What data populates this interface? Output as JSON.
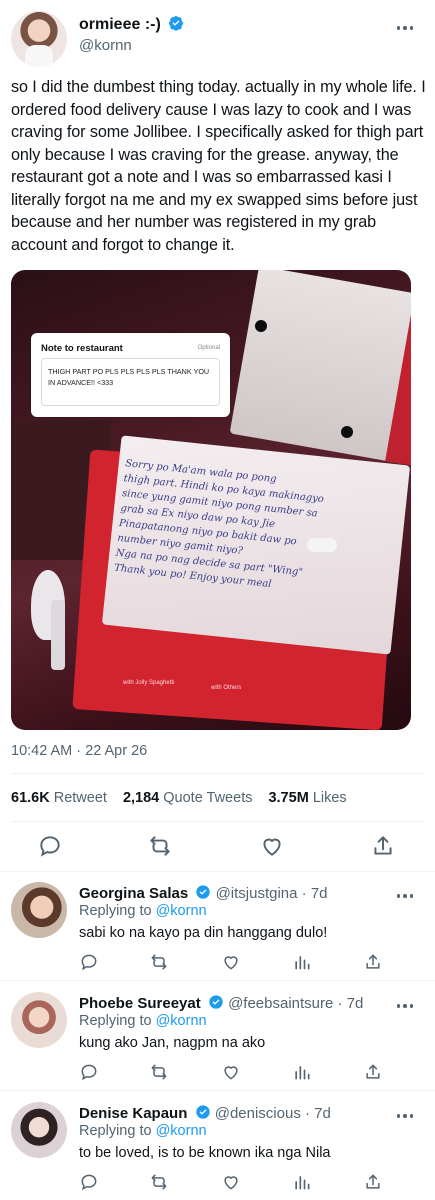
{
  "tweet": {
    "author_name": "ormieee :-)",
    "handle": "@kornn",
    "text": "so I did the dumbest thing today. actually in my whole life. I ordered food delivery cause I was lazy to cook and I was craving for some Jollibee. I specifically asked for thigh part only because I was craving for the grease. anyway, the restaurant got a note and I was so embarrassed kasi I literally forgot na me and my ex swapped sims before just because and her number was registered in my grab account and forgot to change it.",
    "timestamp": "10:42 AM · 22 Apr 26",
    "retweets": "61.6K",
    "retweets_label": "Retweet",
    "quote_tweets": "2,184",
    "quote_tweets_label": "Quote Tweets",
    "likes": "3.75M",
    "likes_label": "Likes"
  },
  "media": {
    "note_title": "Note to restaurant",
    "note_optional": "Optional",
    "note_text": "THIGH PART PO PLS PLS PLS PLS THANK YOU IN ADVANCE!! <333",
    "handwriting": [
      "Sorry po Ma'am wala po pong",
      "thigh part. Hindi ko po kaya makinagyo",
      "since yung gamit niyo pong number sa",
      "grab sa Ex niyo daw po kay Jie",
      "Pinapatanong niyo po bakit daw po",
      "number niyo gamit niyo?",
      "Nga na po nag decide sa part \"Wing\"",
      "Thank you po! Enjoy your meal"
    ],
    "box_label_1": "with Jolly Spaghetti",
    "box_label_2": "with Others"
  },
  "replies": [
    {
      "name": "Georgina Salas",
      "handle": "@itsjustgina · 7d",
      "replying_prefix": "Replying to",
      "replying_to": "@kornn",
      "text": "sabi ko na kayo pa din hanggang dulo!"
    },
    {
      "name": "Phoebe Sureeyat",
      "handle": "@feebsaintsure · 7d",
      "replying_prefix": "Replying to",
      "replying_to": "@kornn",
      "text": "kung ako Jan, nagpm na ako"
    },
    {
      "name": "Denise Kapaun",
      "handle": "@deniscious · 7d",
      "replying_prefix": "Replying to",
      "replying_to": "@kornn",
      "text": "to be loved, is to be known ika nga Nila"
    }
  ],
  "colors": {
    "verified": "#1d9bf0",
    "secondary_text": "#536471",
    "mention": "#1d9bf0"
  },
  "icons": [
    "verified-badge-icon",
    "more-icon",
    "reply-icon",
    "retweet-icon",
    "like-icon",
    "share-icon",
    "analytics-icon"
  ]
}
